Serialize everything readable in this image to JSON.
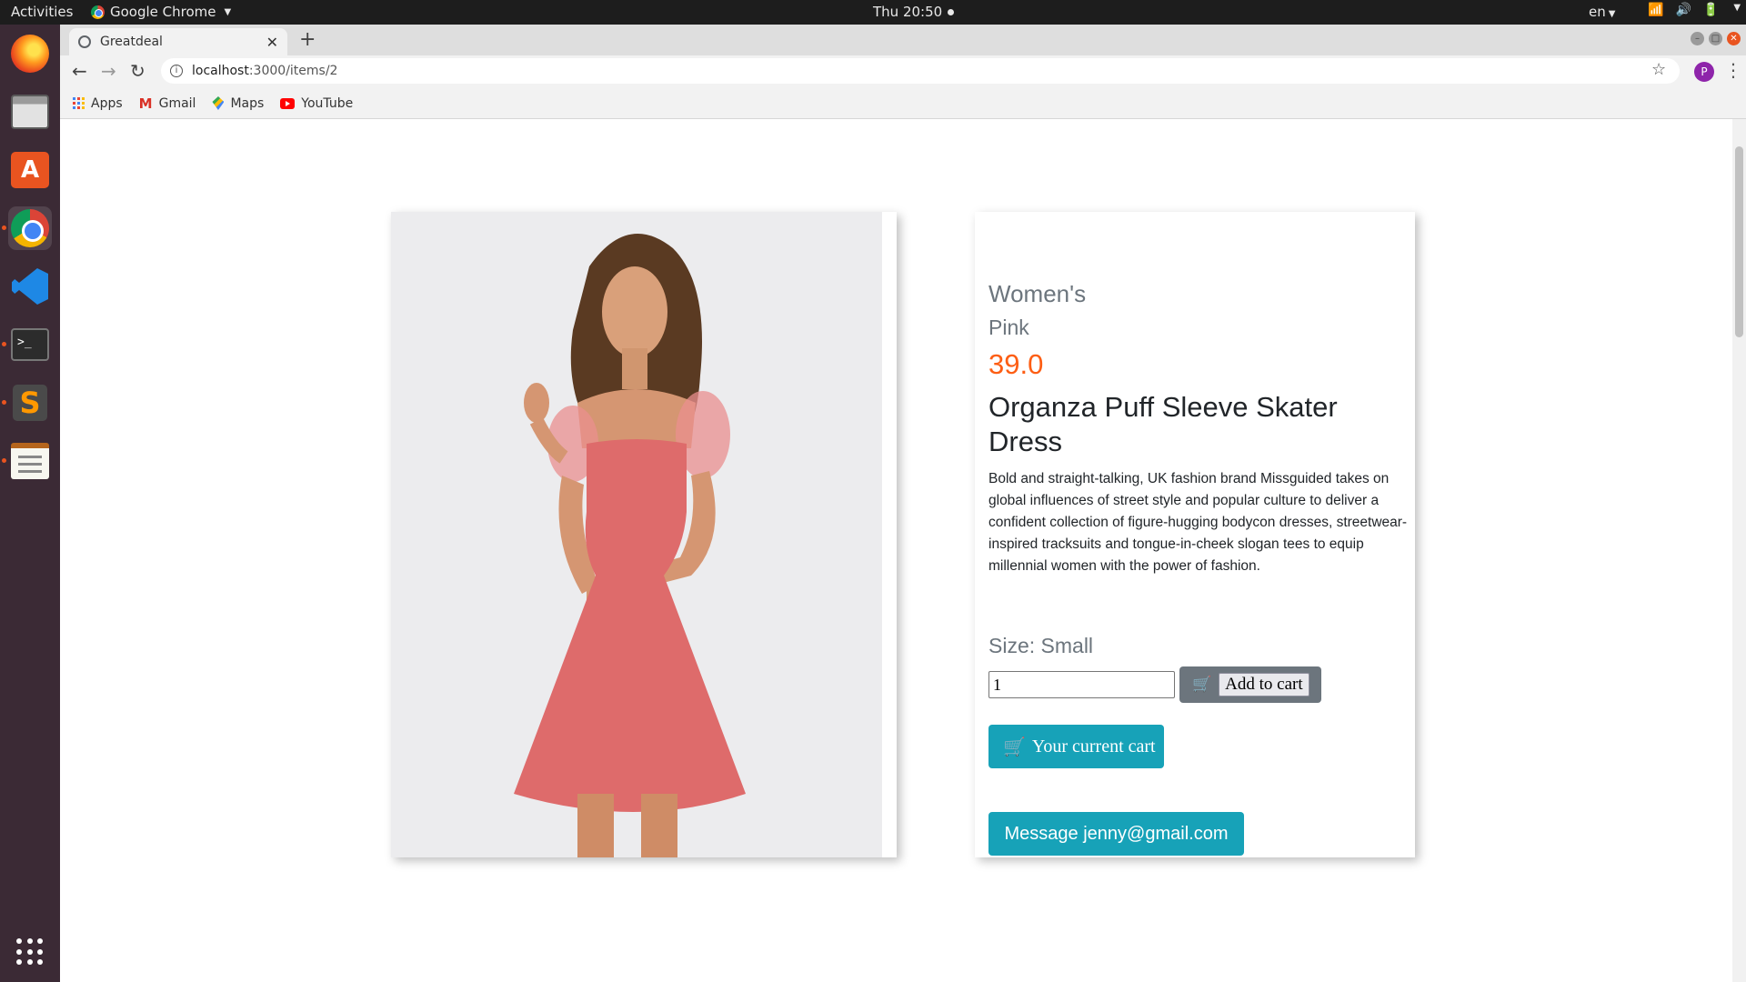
{
  "system": {
    "activities": "Activities",
    "app_name": "Google Chrome",
    "clock": "Thu 20:50",
    "language": "en"
  },
  "dock": {
    "items": [
      "firefox-icon",
      "files-icon",
      "software-store-icon",
      "chrome-icon",
      "vscode-icon",
      "terminal-icon",
      "sublime-text-icon",
      "text-editor-icon"
    ],
    "show_apps": "show-applications-icon"
  },
  "browser": {
    "tab_title": "Greatdeal",
    "url_host": "localhost",
    "url_path": ":3000/items/2",
    "profile_initial": "P",
    "bookmarks": [
      "Apps",
      "Gmail",
      "Maps",
      "YouTube"
    ]
  },
  "product": {
    "category": "Women's",
    "color": "Pink",
    "price": "39.0",
    "title": "Organza Puff Sleeve Skater Dress",
    "description": "Bold and straight-talking, UK fashion brand Missguided takes on global influences of street style and popular culture to deliver a confident collection of figure-hugging bodycon dresses, streetwear-inspired tracksuits and tongue-in-cheek slogan tees to equip millennial women with the power of fashion.",
    "size_label": "Size: Small",
    "quantity": "1",
    "add_to_cart_label": "Add to cart",
    "current_cart_label": "Your current cart",
    "message_label": "Message jenny@gmail.com"
  },
  "colors": {
    "price": "#fd5e14",
    "info_button": "#17a2b8",
    "secondary_button": "#6c757d",
    "dock": "#3b2a35"
  }
}
